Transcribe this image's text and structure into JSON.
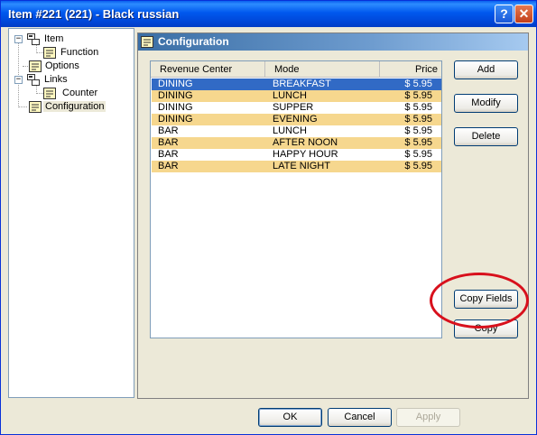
{
  "window": {
    "title": "Item #221 (221) - Black russian",
    "help_label": "?",
    "close_label": "✕"
  },
  "tree": {
    "nodes": [
      {
        "label": "Item",
        "expander": "−",
        "icon": "folder-tree-icon"
      },
      {
        "label": "Function",
        "icon": "config-icon"
      },
      {
        "label": "Options",
        "icon": "config-icon"
      },
      {
        "label": "Links",
        "expander": "−",
        "icon": "folder-tree-icon"
      },
      {
        "label": "Counter",
        "icon": "config-icon"
      },
      {
        "label": "Configuration",
        "icon": "config-icon",
        "selected": true
      }
    ]
  },
  "panel": {
    "title": "Configuration"
  },
  "grid": {
    "columns": [
      "Revenue Center",
      "Mode",
      "Price"
    ],
    "rows": [
      {
        "center": "DINING",
        "mode": "BREAKFAST",
        "price": "$ 5.95"
      },
      {
        "center": "DINING",
        "mode": "LUNCH",
        "price": "$ 5.95"
      },
      {
        "center": "DINING",
        "mode": "SUPPER",
        "price": "$ 5.95"
      },
      {
        "center": "DINING",
        "mode": "EVENING",
        "price": "$ 5.95"
      },
      {
        "center": "BAR",
        "mode": "LUNCH",
        "price": "$ 5.95"
      },
      {
        "center": "BAR",
        "mode": "AFTER NOON",
        "price": "$ 5.95"
      },
      {
        "center": "BAR",
        "mode": "HAPPY HOUR",
        "price": "$ 5.95"
      },
      {
        "center": "BAR",
        "mode": "LATE NIGHT",
        "price": "$ 5.95"
      }
    ]
  },
  "actions": {
    "add": "Add",
    "modify": "Modify",
    "delete": "Delete",
    "copy_fields": "Copy Fields",
    "copy": "Copy"
  },
  "footer": {
    "ok": "OK",
    "cancel": "Cancel",
    "apply": "Apply"
  },
  "colors": {
    "selection": "#316AC5",
    "alt_row": "#F6D78E",
    "annotation_ring": "#D8101C"
  }
}
